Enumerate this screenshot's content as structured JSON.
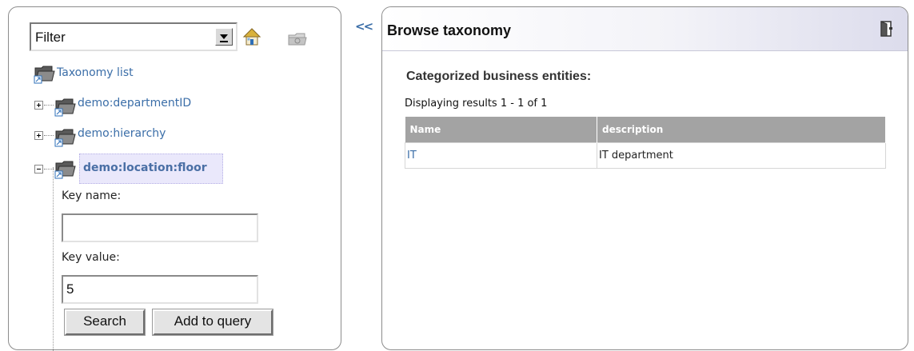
{
  "left": {
    "filter": {
      "value": "Filter"
    },
    "tree": {
      "root": "Taxonomy list",
      "items": [
        {
          "label": "demo:departmentID"
        },
        {
          "label": "demo:hierarchy"
        },
        {
          "label": "demo:location:floor"
        }
      ]
    },
    "form": {
      "key_name_label": "Key name:",
      "key_name_value": "",
      "key_value_label": "Key value:",
      "key_value_value": "5",
      "search_label": "Search",
      "add_label": "Add to query"
    }
  },
  "collapse_label": "<<",
  "right": {
    "title": "Browse taxonomy",
    "section_title": "Categorized business entities:",
    "results_info": "Displaying results 1 - 1 of 1",
    "table": {
      "headers": [
        "Name",
        "description"
      ],
      "rows": [
        {
          "name": "IT",
          "description": "IT department"
        }
      ]
    }
  },
  "colors": {
    "link": "#3b6ea8",
    "selected_bg": "#eae8fb",
    "table_header_bg": "#a3a3a3"
  },
  "icons": [
    "chevron-down-icon",
    "home-icon",
    "disabled-folder-icon",
    "folder-icon",
    "expand-icon",
    "collapse-icon",
    "exit-icon"
  ]
}
